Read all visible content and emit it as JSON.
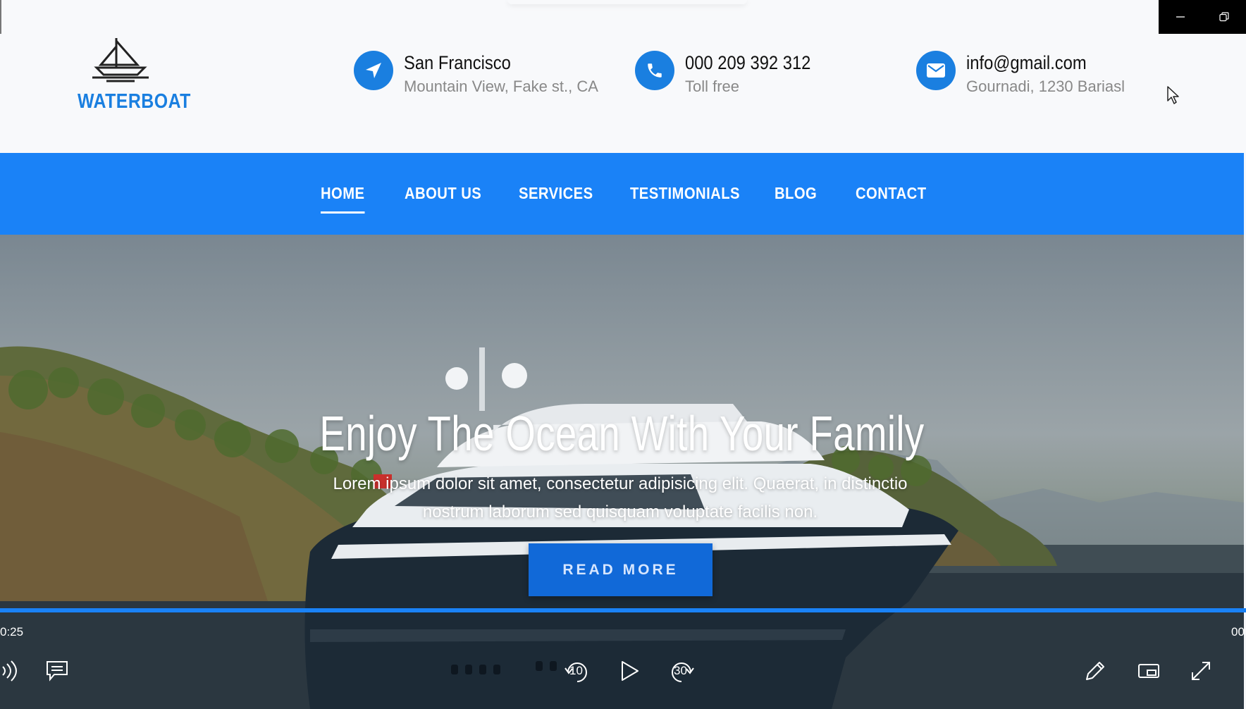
{
  "brand": {
    "name": "WATERBOAT",
    "icon": "sailboat-icon",
    "accent_color": "#1a82f7"
  },
  "contacts": [
    {
      "icon": "location-arrow-icon",
      "title": "San Francisco",
      "subtitle": "Mountain View, Fake st., CA"
    },
    {
      "icon": "phone-icon",
      "title": "000 209 392 312",
      "subtitle": "Toll free"
    },
    {
      "icon": "envelope-icon",
      "title": "info@gmail.com",
      "subtitle": "Gournadi, 1230 Bariasl"
    }
  ],
  "nav": {
    "items": [
      {
        "label": "HOME",
        "active": true
      },
      {
        "label": "ABOUT US"
      },
      {
        "label": "SERVICES"
      },
      {
        "label": "TESTIMONIALS"
      },
      {
        "label": "BLOG"
      },
      {
        "label": "CONTACT"
      }
    ]
  },
  "hero": {
    "title": "Enjoy The Ocean With Your Family",
    "text_line1": "Lorem ipsum dolor sit amet, consectetur adipisicing elit. Quaerat, in distinctio",
    "text_line2": "nostrum laborum sed quisquam voluptate facilis non.",
    "button_label": "READ MORE"
  },
  "player": {
    "current_time": "0:25",
    "end_time": "00",
    "controls": [
      "volume-icon",
      "captions-icon",
      "rewind-10-icon",
      "play-icon",
      "forward-30-icon",
      "edit-pen-icon",
      "miniplayer-icon",
      "fullscreen-icon"
    ],
    "rewind_seconds": "10",
    "forward_seconds": "30"
  }
}
